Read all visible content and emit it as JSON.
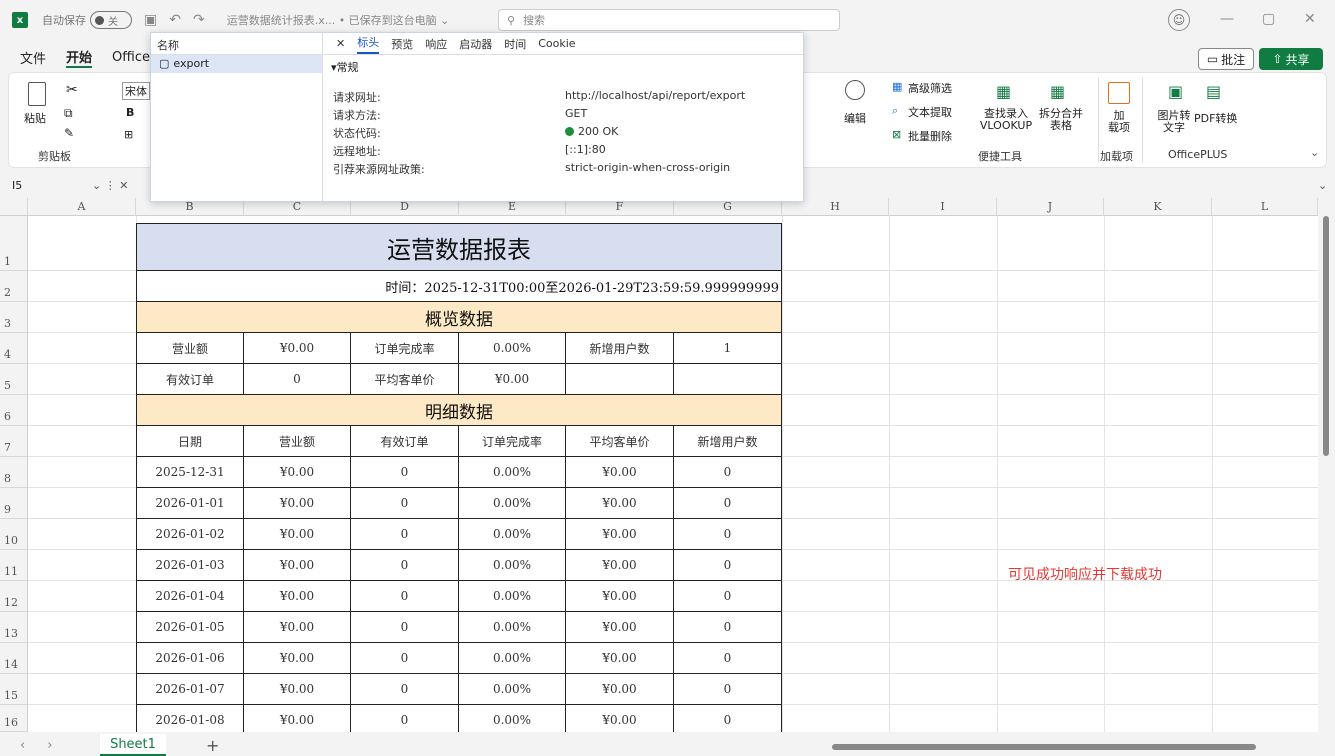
{
  "titlebar": {
    "autosave_label": "自动保存",
    "autosave_state": "关",
    "file_title": "运营数据统计报表.x... • 已保存到这台电脑 ⌄",
    "search_placeholder": "搜索"
  },
  "menu": {
    "items": [
      "文件",
      "开始",
      "OfficeP"
    ],
    "comment": "批注",
    "share": "共享"
  },
  "ribbon": {
    "paste": "粘贴",
    "clipboard_group": "剪贴板",
    "font_name": "宋体",
    "bold": "B",
    "edit": "编辑",
    "advanced_filter": "高级筛选",
    "text_extract": "文本提取",
    "batch_delete": "批量删除",
    "lookup": "查找录入 VLOOKUP",
    "split_merge": "拆分合并 表格",
    "quick_tools_group": "便捷工具",
    "addin": "加 载项",
    "addin_group": "加载项",
    "img_to_text": "图片转 文字",
    "pdf_convert": "PDF转换",
    "officeplus_group": "OfficePLUS"
  },
  "formula_bar": {
    "cell_ref": "I5"
  },
  "columns": [
    "A",
    "B",
    "C",
    "D",
    "E",
    "F",
    "G",
    "H",
    "I",
    "J",
    "K",
    "L"
  ],
  "rows": [
    "1",
    "2",
    "3",
    "4",
    "5",
    "6",
    "7",
    "8",
    "9",
    "10",
    "11",
    "12",
    "13",
    "14",
    "15",
    "16"
  ],
  "report": {
    "title": "运营数据报表",
    "time_range": "时间：2025-12-31T00:00至2026-01-29T23:59:59.999999999",
    "overview_header": "概览数据",
    "overview_rows": [
      [
        "营业额",
        "¥0.00",
        "订单完成率",
        "0.00%",
        "新增用户数",
        "1"
      ],
      [
        "有效订单",
        "0",
        "平均客单价",
        "¥0.00",
        "",
        ""
      ]
    ],
    "detail_header": "明细数据",
    "detail_columns": [
      "日期",
      "营业额",
      "有效订单",
      "订单完成率",
      "平均客单价",
      "新增用户数"
    ],
    "detail_rows": [
      [
        "2025-12-31",
        "¥0.00",
        "0",
        "0.00%",
        "¥0.00",
        "0"
      ],
      [
        "2026-01-01",
        "¥0.00",
        "0",
        "0.00%",
        "¥0.00",
        "0"
      ],
      [
        "2026-01-02",
        "¥0.00",
        "0",
        "0.00%",
        "¥0.00",
        "0"
      ],
      [
        "2026-01-03",
        "¥0.00",
        "0",
        "0.00%",
        "¥0.00",
        "0"
      ],
      [
        "2026-01-04",
        "¥0.00",
        "0",
        "0.00%",
        "¥0.00",
        "0"
      ],
      [
        "2026-01-05",
        "¥0.00",
        "0",
        "0.00%",
        "¥0.00",
        "0"
      ],
      [
        "2026-01-06",
        "¥0.00",
        "0",
        "0.00%",
        "¥0.00",
        "0"
      ],
      [
        "2026-01-07",
        "¥0.00",
        "0",
        "0.00%",
        "¥0.00",
        "0"
      ],
      [
        "2026-01-08",
        "¥0.00",
        "0",
        "0.00%",
        "¥0.00",
        "0"
      ]
    ]
  },
  "annotation": "可见成功响应并下载成功",
  "sheet_tab": "Sheet1",
  "devtools": {
    "name_header": "名称",
    "request_name": "export",
    "tabs": [
      "标头",
      "预览",
      "响应",
      "启动器",
      "时间",
      "Cookie"
    ],
    "section": "▾常规",
    "fields": [
      {
        "label": "请求网址:",
        "value": "http://localhost/api/report/export"
      },
      {
        "label": "请求方法:",
        "value": "GET"
      },
      {
        "label": "状态代码:",
        "value": "200 OK"
      },
      {
        "label": "远程地址:",
        "value": "[::1]:80"
      },
      {
        "label": "引荐来源网址政策:",
        "value": "strict-origin-when-cross-origin"
      }
    ]
  },
  "colors": {
    "excel_green": "#107c41",
    "title_fill": "#d7deef",
    "section_fill": "#fde9c5",
    "note_red": "#e53935"
  }
}
